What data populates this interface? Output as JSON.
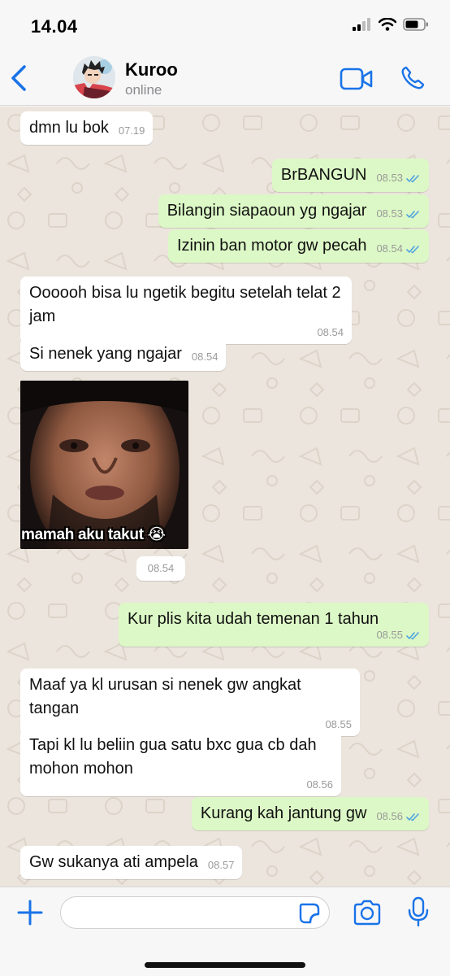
{
  "status_bar": {
    "time": "14.04"
  },
  "header": {
    "contact_name": "Kuroo",
    "contact_status": "online"
  },
  "messages": [
    {
      "text": "dmn lu bok",
      "time": "07.19"
    },
    {
      "text": "BrBANGUN",
      "time": "08.53"
    },
    {
      "text": "Bilangin siapaoun yg ngajar",
      "time": "08.53"
    },
    {
      "text": "Izinin ban motor gw pecah",
      "time": "08.54"
    },
    {
      "text": "Oooooh bisa lu ngetik begitu setelah telat 2 jam",
      "time": "08.54"
    },
    {
      "text": "Si nenek yang ngajar",
      "time": "08.54"
    },
    {
      "text": "Kur plis kita udah temenan 1 tahun",
      "time": "08.55"
    },
    {
      "text": "Maaf ya kl urusan si nenek gw angkat tangan",
      "time": "08.55"
    },
    {
      "text": "Tapi kl lu beliin gua satu bxc gua cb dah mohon mohon",
      "time": "08.56"
    },
    {
      "text": "Kurang kah jantung gw",
      "time": "08.56"
    },
    {
      "text": "Gw sukanya ati ampela",
      "time": "08.57"
    }
  ],
  "sticker": {
    "caption": "mamah aku takut 😭",
    "time": "08.54"
  },
  "input": {
    "placeholder": ""
  },
  "colors": {
    "accent": "#1a73e8",
    "outgoing_bubble": "#dcf8c6",
    "incoming_bubble": "#ffffff",
    "read_ticks": "#4fa3e0",
    "wallpaper": "#ece5dd"
  },
  "icons": [
    "back-chevron-icon",
    "video-call-icon",
    "phone-icon",
    "plus-icon",
    "sticker-icon",
    "camera-icon",
    "microphone-icon",
    "read-ticks-icon",
    "signal-icon",
    "wifi-icon",
    "battery-icon"
  ]
}
